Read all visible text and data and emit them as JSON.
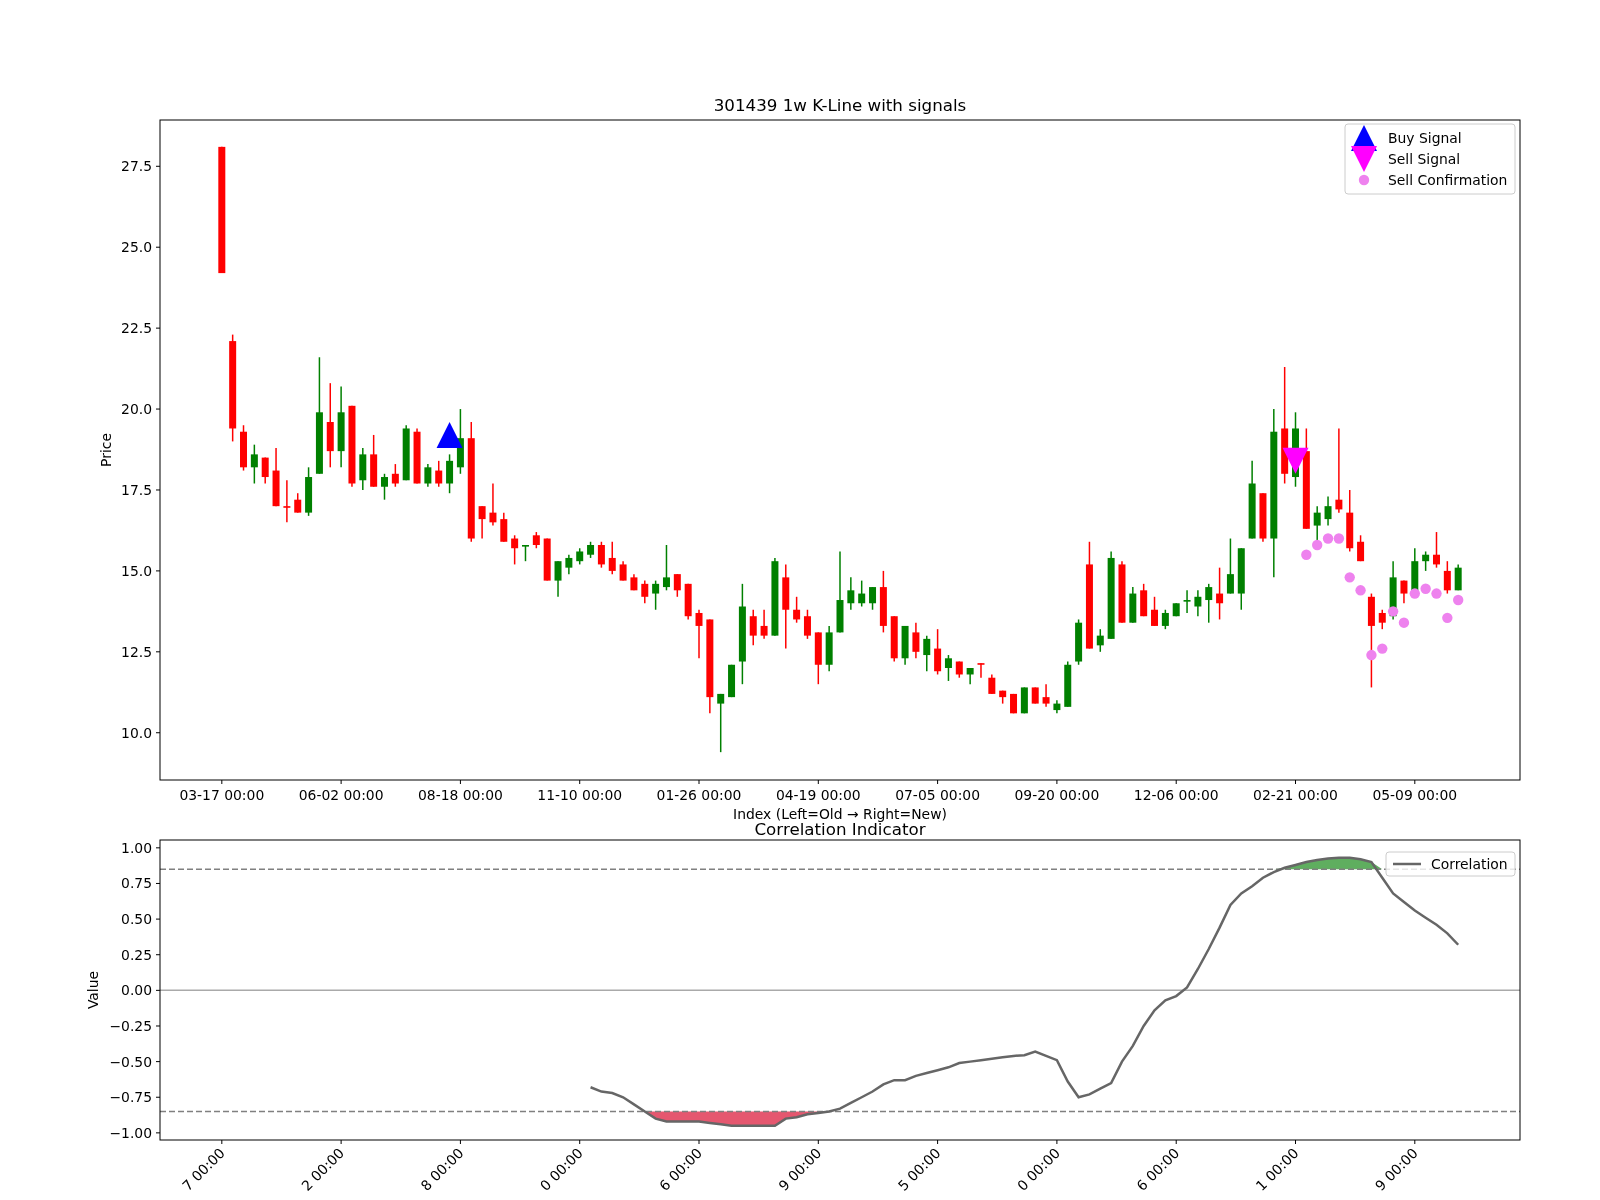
{
  "price_chart": {
    "chart_data": {
      "type": "candlestick",
      "title": "301439 1w K-Line with signals",
      "xlabel": "Index (Left=Old → Right=New)",
      "ylabel": "Price",
      "ylim": [
        8.54,
        28.93
      ],
      "legend": "upper right",
      "categories": [
        "03-17 00:00",
        null,
        null,
        null,
        null,
        null,
        null,
        null,
        null,
        null,
        null,
        "06-02 00:00",
        null,
        null,
        null,
        null,
        null,
        null,
        null,
        null,
        null,
        null,
        "08-18 00:00",
        null,
        null,
        null,
        null,
        null,
        null,
        null,
        null,
        null,
        null,
        "11-10 00:00",
        null,
        null,
        null,
        null,
        null,
        null,
        null,
        null,
        null,
        null,
        "01-26 00:00",
        null,
        null,
        null,
        null,
        null,
        null,
        null,
        null,
        null,
        null,
        "04-19 00:00",
        null,
        null,
        null,
        null,
        null,
        null,
        null,
        null,
        null,
        null,
        "07-05 00:00",
        null,
        null,
        null,
        null,
        null,
        null,
        null,
        null,
        null,
        null,
        "09-20 00:00",
        null,
        null,
        null,
        null,
        null,
        null,
        null,
        null,
        null,
        null,
        "12-06 00:00",
        null,
        null,
        null,
        null,
        null,
        null,
        null,
        null,
        null,
        null,
        "02-21 00:00",
        null,
        null,
        null,
        null,
        null,
        null,
        null,
        null,
        null,
        null,
        "05-09 00:00",
        null,
        null,
        null,
        null
      ],
      "yticks": [
        {
          "value": 10,
          "label": "10.0"
        },
        {
          "value": 12.5,
          "label": "12.5"
        },
        {
          "value": 15,
          "label": "15.0"
        },
        {
          "value": 17.5,
          "label": "17.5"
        },
        {
          "value": 20,
          "label": "20.0"
        },
        {
          "value": 22.5,
          "label": "22.5"
        },
        {
          "value": 25,
          "label": "25.0"
        },
        {
          "value": 27.5,
          "label": "27.5"
        }
      ],
      "ohlc": [
        [
          28.1,
          28.1,
          24.2,
          24.2
        ],
        [
          22.1,
          22.3,
          19.0,
          19.4
        ],
        [
          19.3,
          19.5,
          18.1,
          18.2
        ],
        [
          18.2,
          18.9,
          17.7,
          18.6
        ],
        [
          18.5,
          18.5,
          17.7,
          17.9
        ],
        [
          18.1,
          18.8,
          17.0,
          17.0
        ],
        [
          17.0,
          17.8,
          16.5,
          16.95
        ],
        [
          17.2,
          17.4,
          16.8,
          16.8
        ],
        [
          16.8,
          18.2,
          16.7,
          17.9
        ],
        [
          18.0,
          21.6,
          18.0,
          19.9
        ],
        [
          19.6,
          20.8,
          18.2,
          18.7
        ],
        [
          18.7,
          20.7,
          18.2,
          19.9
        ],
        [
          20.1,
          20.1,
          17.6,
          17.7
        ],
        [
          17.8,
          18.8,
          17.5,
          18.6
        ],
        [
          18.6,
          19.2,
          17.6,
          17.6
        ],
        [
          17.6,
          18.0,
          17.2,
          17.9
        ],
        [
          18.0,
          18.3,
          17.6,
          17.7
        ],
        [
          17.8,
          19.5,
          17.8,
          19.4
        ],
        [
          19.3,
          19.4,
          17.7,
          17.7
        ],
        [
          17.7,
          18.3,
          17.6,
          18.2
        ],
        [
          18.1,
          18.4,
          17.6,
          17.7
        ],
        [
          17.7,
          18.6,
          17.4,
          18.4
        ],
        [
          18.2,
          20.0,
          18.0,
          19.1
        ],
        [
          19.1,
          19.6,
          15.9,
          16.0
        ],
        [
          17.0,
          17.0,
          16.0,
          16.6
        ],
        [
          16.8,
          17.7,
          16.4,
          16.5
        ],
        [
          16.6,
          16.8,
          15.9,
          15.9
        ],
        [
          16.0,
          16.1,
          15.2,
          15.7
        ],
        [
          15.75,
          15.8,
          15.3,
          15.8
        ],
        [
          16.1,
          16.2,
          15.7,
          15.8
        ],
        [
          16.0,
          16.0,
          14.7,
          14.7
        ],
        [
          14.7,
          15.3,
          14.2,
          15.3
        ],
        [
          15.1,
          15.5,
          14.9,
          15.4
        ],
        [
          15.3,
          15.7,
          15.2,
          15.6
        ],
        [
          15.5,
          15.9,
          15.4,
          15.8
        ],
        [
          15.8,
          15.9,
          15.1,
          15.2
        ],
        [
          15.4,
          15.9,
          14.9,
          15.0
        ],
        [
          15.2,
          15.3,
          14.7,
          14.7
        ],
        [
          14.8,
          14.9,
          14.4,
          14.4
        ],
        [
          14.6,
          14.7,
          14.0,
          14.2
        ],
        [
          14.3,
          14.7,
          13.8,
          14.6
        ],
        [
          14.5,
          15.8,
          14.4,
          14.8
        ],
        [
          14.9,
          14.9,
          14.2,
          14.4
        ],
        [
          14.6,
          14.6,
          13.5,
          13.6
        ],
        [
          13.7,
          13.8,
          12.3,
          13.3
        ],
        [
          13.5,
          13.5,
          10.6,
          11.1
        ],
        [
          10.9,
          11.2,
          9.4,
          11.2
        ],
        [
          11.1,
          12.1,
          11.1,
          12.1
        ],
        [
          12.2,
          14.6,
          11.5,
          13.9
        ],
        [
          13.6,
          13.8,
          12.7,
          13.0
        ],
        [
          13.3,
          13.8,
          12.9,
          13.0
        ],
        [
          13.0,
          15.4,
          13.0,
          15.3
        ],
        [
          14.8,
          15.2,
          12.6,
          13.8
        ],
        [
          13.8,
          14.2,
          13.4,
          13.5
        ],
        [
          13.6,
          13.8,
          12.9,
          13.0
        ],
        [
          13.1,
          13.1,
          11.5,
          12.1
        ],
        [
          12.1,
          13.3,
          11.9,
          13.1
        ],
        [
          13.1,
          15.6,
          13.1,
          14.1
        ],
        [
          14.0,
          14.8,
          13.8,
          14.4
        ],
        [
          14.0,
          14.7,
          13.9,
          14.3
        ],
        [
          14.0,
          14.5,
          13.8,
          14.5
        ],
        [
          14.5,
          15.0,
          13.1,
          13.3
        ],
        [
          13.6,
          13.6,
          12.2,
          12.3
        ],
        [
          12.3,
          13.3,
          12.1,
          13.3
        ],
        [
          13.1,
          13.4,
          12.3,
          12.5
        ],
        [
          12.4,
          13.0,
          11.9,
          12.9
        ],
        [
          12.6,
          13.2,
          11.8,
          11.9
        ],
        [
          12.0,
          12.4,
          11.6,
          12.3
        ],
        [
          12.2,
          12.2,
          11.7,
          11.8
        ],
        [
          11.8,
          12.0,
          11.5,
          12.0
        ],
        [
          12.15,
          12.15,
          11.7,
          12.1
        ],
        [
          11.7,
          11.8,
          11.2,
          11.2
        ],
        [
          11.3,
          11.3,
          10.9,
          11.1
        ],
        [
          11.2,
          11.2,
          10.6,
          10.6
        ],
        [
          10.6,
          11.4,
          10.6,
          11.4
        ],
        [
          11.4,
          11.4,
          10.9,
          10.9
        ],
        [
          11.1,
          11.5,
          10.8,
          10.9
        ],
        [
          10.7,
          11.0,
          10.6,
          10.9
        ],
        [
          10.8,
          12.2,
          10.8,
          12.1
        ],
        [
          12.2,
          13.5,
          12.1,
          13.4
        ],
        [
          15.2,
          15.9,
          12.6,
          12.6
        ],
        [
          12.7,
          13.2,
          12.5,
          13.0
        ],
        [
          12.9,
          15.6,
          12.9,
          15.4
        ],
        [
          15.2,
          15.3,
          13.4,
          13.4
        ],
        [
          13.4,
          14.5,
          13.4,
          14.3
        ],
        [
          14.4,
          14.6,
          13.6,
          13.6
        ],
        [
          13.8,
          14.2,
          13.3,
          13.3
        ],
        [
          13.3,
          13.8,
          13.2,
          13.7
        ],
        [
          13.6,
          14.0,
          13.6,
          14.0
        ],
        [
          14.05,
          14.4,
          13.7,
          14.1
        ],
        [
          13.9,
          14.4,
          13.6,
          14.2
        ],
        [
          14.1,
          14.6,
          13.4,
          14.5
        ],
        [
          14.3,
          15.1,
          13.5,
          14.0
        ],
        [
          14.3,
          16.0,
          14.3,
          14.9
        ],
        [
          14.3,
          15.7,
          13.8,
          15.7
        ],
        [
          16.0,
          18.4,
          16.0,
          17.7
        ],
        [
          17.4,
          17.4,
          15.9,
          16.0
        ],
        [
          16.0,
          20.0,
          14.8,
          19.3
        ],
        [
          19.4,
          21.3,
          17.7,
          18.0
        ],
        [
          17.9,
          19.9,
          17.6,
          19.4
        ],
        [
          18.7,
          19.4,
          16.3,
          16.3
        ],
        [
          16.4,
          17.0,
          15.9,
          16.8
        ],
        [
          16.6,
          17.3,
          16.4,
          17.0
        ],
        [
          17.2,
          19.4,
          16.8,
          16.9
        ],
        [
          16.8,
          17.5,
          15.6,
          15.7
        ],
        [
          15.9,
          16.1,
          15.3,
          15.3
        ],
        [
          14.2,
          14.3,
          11.4,
          13.3
        ],
        [
          13.7,
          13.8,
          13.2,
          13.4
        ],
        [
          13.6,
          15.3,
          13.5,
          14.8
        ],
        [
          14.7,
          14.7,
          14.0,
          14.3
        ],
        [
          14.3,
          15.7,
          14.3,
          15.3
        ],
        [
          15.3,
          15.6,
          15.0,
          15.5
        ],
        [
          15.5,
          16.2,
          15.1,
          15.2
        ],
        [
          15.0,
          15.3,
          14.3,
          14.4
        ],
        [
          14.4,
          15.2,
          14.4,
          15.1
        ]
      ],
      "series": [
        {
          "name": "Buy Signal",
          "type": "scatter",
          "color": "#0000ff",
          "values": [
            null,
            null,
            null,
            null,
            null,
            null,
            null,
            null,
            null,
            null,
            null,
            null,
            null,
            null,
            null,
            null,
            null,
            null,
            null,
            null,
            null,
            19.2,
            null,
            null,
            null,
            null,
            null,
            null,
            null,
            null,
            null,
            null,
            null,
            null,
            null,
            null,
            null,
            null,
            null,
            null,
            null,
            null,
            null,
            null,
            null,
            null,
            null,
            null,
            null,
            null,
            null,
            null,
            null,
            null,
            null,
            null,
            null,
            null,
            null,
            null,
            null,
            null,
            null,
            null,
            null,
            null,
            null,
            null,
            null,
            null,
            null,
            null,
            null,
            null,
            null,
            null,
            null,
            null,
            null,
            null,
            null,
            null,
            null,
            null,
            null,
            null,
            null,
            null,
            null,
            null,
            null,
            null,
            null,
            null,
            null,
            null,
            null,
            null,
            null,
            null,
            null,
            null,
            null,
            null,
            null,
            null,
            null,
            null,
            null,
            null,
            null,
            null,
            null,
            null,
            null
          ]
        },
        {
          "name": "Sell Signal",
          "type": "scatter",
          "color": "#ff00ff",
          "values": [
            null,
            null,
            null,
            null,
            null,
            null,
            null,
            null,
            null,
            null,
            null,
            null,
            null,
            null,
            null,
            null,
            null,
            null,
            null,
            null,
            null,
            null,
            null,
            null,
            null,
            null,
            null,
            null,
            null,
            null,
            null,
            null,
            null,
            null,
            null,
            null,
            null,
            null,
            null,
            null,
            null,
            null,
            null,
            null,
            null,
            null,
            null,
            null,
            null,
            null,
            null,
            null,
            null,
            null,
            null,
            null,
            null,
            null,
            null,
            null,
            null,
            null,
            null,
            null,
            null,
            null,
            null,
            null,
            null,
            null,
            null,
            null,
            null,
            null,
            null,
            null,
            null,
            null,
            null,
            null,
            null,
            null,
            null,
            null,
            null,
            null,
            null,
            null,
            null,
            null,
            null,
            null,
            null,
            null,
            null,
            null,
            null,
            null,
            null,
            18.4,
            null,
            null,
            null,
            null,
            null,
            null,
            null,
            null,
            null,
            null,
            null,
            null,
            null,
            null,
            null
          ]
        },
        {
          "name": "Sell Confirmation",
          "type": "scatter",
          "color": "#ee82ee",
          "values": [
            null,
            null,
            null,
            null,
            null,
            null,
            null,
            null,
            null,
            null,
            null,
            null,
            null,
            null,
            null,
            null,
            null,
            null,
            null,
            null,
            null,
            null,
            null,
            null,
            null,
            null,
            null,
            null,
            null,
            null,
            null,
            null,
            null,
            null,
            null,
            null,
            null,
            null,
            null,
            null,
            null,
            null,
            null,
            null,
            null,
            null,
            null,
            null,
            null,
            null,
            null,
            null,
            null,
            null,
            null,
            null,
            null,
            null,
            null,
            null,
            null,
            null,
            null,
            null,
            null,
            null,
            null,
            null,
            null,
            null,
            null,
            null,
            null,
            null,
            null,
            null,
            null,
            null,
            null,
            null,
            null,
            null,
            null,
            null,
            null,
            null,
            null,
            null,
            null,
            null,
            null,
            null,
            null,
            null,
            null,
            null,
            null,
            null,
            null,
            null,
            15.5,
            15.8,
            16.0,
            16.0,
            14.8,
            14.4,
            12.4,
            12.6,
            13.75,
            13.4,
            14.3,
            14.45,
            14.3,
            13.55,
            14.1
          ]
        }
      ]
    }
  },
  "correlation_chart": {
    "chart_data": {
      "type": "line",
      "title": "Correlation Indicator",
      "ylabel": "Value",
      "ylim": [
        -1.05,
        1.055
      ],
      "legend": "upper right",
      "categories": [
        "7 00:00",
        null,
        null,
        null,
        null,
        null,
        null,
        null,
        null,
        null,
        null,
        "2 00:00",
        null,
        null,
        null,
        null,
        null,
        null,
        null,
        null,
        null,
        null,
        "8 00:00",
        null,
        null,
        null,
        null,
        null,
        null,
        null,
        null,
        null,
        null,
        "0 00:00",
        null,
        null,
        null,
        null,
        null,
        null,
        null,
        null,
        null,
        null,
        "6 00:00",
        null,
        null,
        null,
        null,
        null,
        null,
        null,
        null,
        null,
        null,
        "9 00:00",
        null,
        null,
        null,
        null,
        null,
        null,
        null,
        null,
        null,
        null,
        "5 00:00",
        null,
        null,
        null,
        null,
        null,
        null,
        null,
        null,
        null,
        null,
        "0 00:00",
        null,
        null,
        null,
        null,
        null,
        null,
        null,
        null,
        null,
        null,
        "6 00:00",
        null,
        null,
        null,
        null,
        null,
        null,
        null,
        null,
        null,
        null,
        "1 00:00",
        null,
        null,
        null,
        null,
        null,
        null,
        null,
        null,
        null,
        null,
        "9 00:00",
        null,
        null,
        null,
        null
      ],
      "yticks": [
        {
          "value": 1,
          "label": "1.00"
        },
        {
          "value": 0.75,
          "label": "0.75"
        },
        {
          "value": 0.5,
          "label": "0.50"
        },
        {
          "value": 0.25,
          "label": "0.25"
        },
        {
          "value": 0,
          "label": "0.00"
        },
        {
          "value": -0.25,
          "label": "−0.25"
        },
        {
          "value": -0.5,
          "label": "−0.50"
        },
        {
          "value": -0.75,
          "label": "−0.75"
        },
        {
          "value": -1,
          "label": "−1.00"
        }
      ],
      "series": [
        {
          "name": "Correlation",
          "color": "#666666",
          "values": [
            null,
            null,
            null,
            null,
            null,
            null,
            null,
            null,
            null,
            null,
            null,
            null,
            null,
            null,
            null,
            null,
            null,
            null,
            null,
            null,
            null,
            null,
            null,
            null,
            null,
            null,
            null,
            null,
            null,
            null,
            null,
            null,
            null,
            null,
            -0.68,
            -0.71,
            -0.72,
            -0.75,
            -0.8,
            -0.85,
            -0.9,
            -0.92,
            -0.92,
            -0.92,
            -0.92,
            -0.93,
            -0.94,
            -0.95,
            -0.95,
            -0.95,
            -0.95,
            -0.95,
            -0.9,
            -0.89,
            -0.87,
            -0.86,
            -0.85,
            -0.83,
            -0.79,
            -0.75,
            -0.71,
            -0.66,
            -0.63,
            -0.63,
            -0.6,
            -0.58,
            -0.56,
            -0.54,
            -0.51,
            -0.5,
            -0.49,
            -0.48,
            -0.47,
            -0.46,
            -0.455,
            -0.43,
            -0.46,
            -0.49,
            -0.64,
            -0.75,
            -0.73,
            -0.69,
            -0.65,
            -0.5,
            -0.39,
            -0.25,
            -0.14,
            -0.07,
            -0.04,
            0.02,
            0.15,
            0.29,
            0.44,
            0.6,
            0.68,
            0.73,
            0.79,
            0.83,
            0.86,
            0.88,
            0.9,
            0.915,
            0.925,
            0.93,
            0.93,
            0.92,
            0.9,
            0.79,
            0.68,
            0.62,
            0.56,
            0.51,
            0.46,
            0.4,
            0.32
          ]
        }
      ],
      "ref_lines": [
        {
          "axis": "y",
          "value": 0.85
        },
        {
          "axis": "y",
          "value": -0.85
        },
        {
          "axis": "y",
          "value": 0
        }
      ]
    }
  }
}
